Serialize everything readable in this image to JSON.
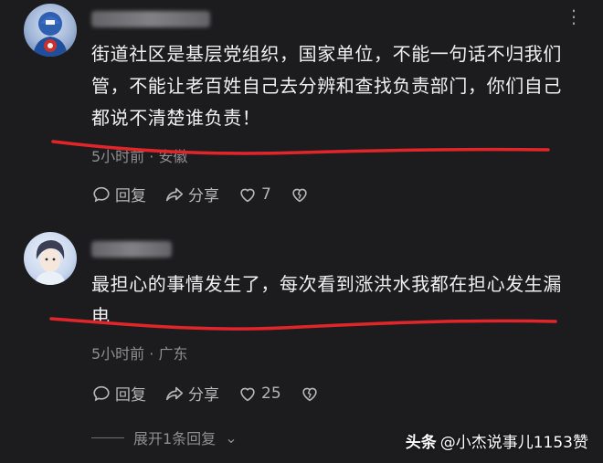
{
  "comments": [
    {
      "text": "街道社区是基层党组织，国家单位，不能一句话不归我们管，不能让老百姓自己去分辨和查找负责部门，你们自己都说不清楚谁负责！",
      "meta": "5小时前 · 安徽",
      "reply_label": "回复",
      "share_label": "分享",
      "like_count": "7"
    },
    {
      "text": "最担心的事情发生了，每次看到涨洪水我都在担心发生漏电",
      "meta": "5小时前 · 广东",
      "reply_label": "回复",
      "share_label": "分享",
      "like_count": "25"
    }
  ],
  "expand_label": "展开1条回复",
  "watermark": {
    "brand": "头条",
    "account": "@小杰说事儿1153赞"
  },
  "colors": {
    "background": "#1c1c1e",
    "underline": "#e0262a",
    "muted": "#8e8e93"
  },
  "icons": [
    "more-icon",
    "comment-icon",
    "share-icon",
    "heart-icon",
    "broken-heart-icon",
    "chevron-down-icon"
  ]
}
